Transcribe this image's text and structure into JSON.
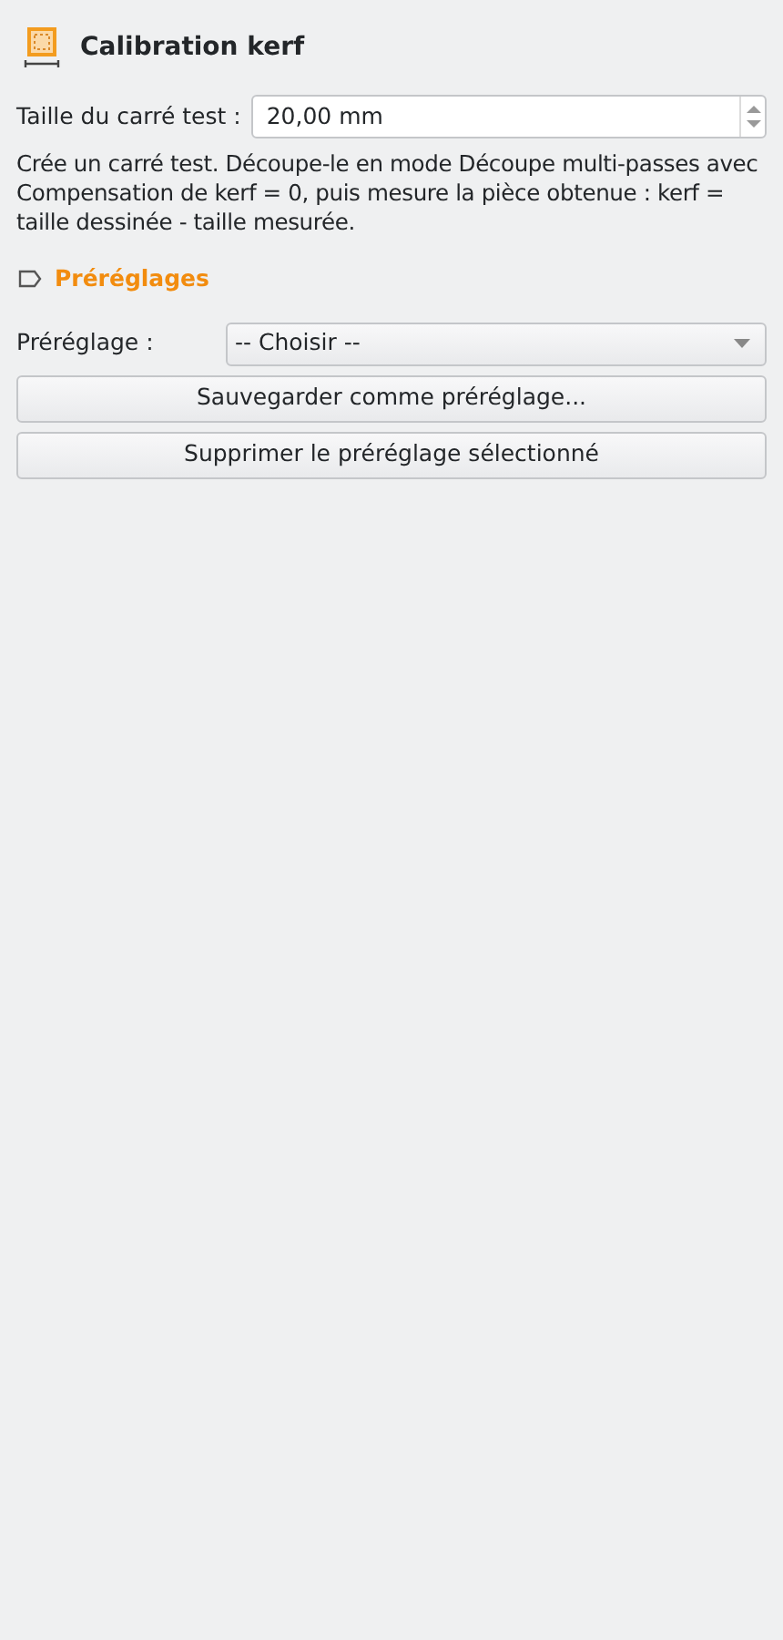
{
  "title": "Calibration kerf",
  "size_field": {
    "label": "Taille du carré test :",
    "value": "20,00 mm"
  },
  "description": "Crée un carré test. Découpe-le en mode Découpe multi-passes avec Compensation de kerf = 0, puis mesure la pièce obtenue : kerf = taille dessinée - taille mesurée.",
  "presets": {
    "heading": "Préréglages",
    "label": "Préréglage :",
    "value": "-- Choisir --",
    "buttons": [
      "Sauvegarder comme préréglage...",
      "Supprimer le préréglage sélectionné"
    ]
  }
}
